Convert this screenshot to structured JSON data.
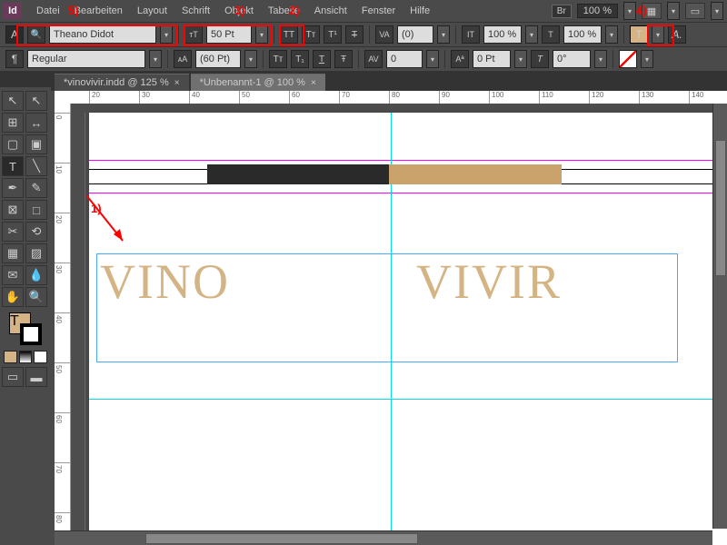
{
  "app": {
    "logo": "Id"
  },
  "menu": [
    "Datei",
    "Bearbeiten",
    "Layout",
    "Schrift",
    "Objekt",
    "Tabelle",
    "Ansicht",
    "Fenster",
    "Hilfe"
  ],
  "top_right": {
    "br": "Br",
    "zoom": "100 %"
  },
  "control": {
    "font_family": "Theano Didot",
    "font_style": "Regular",
    "font_size": "50 Pt",
    "leading": "(60 Pt)",
    "kerning": "(0)",
    "tracking": "0",
    "vscale": "100 %",
    "hscale": "100 %",
    "baseline": "0 Pt"
  },
  "tabs": [
    {
      "label": "*vinovivir.indd @ 125 %",
      "active": false
    },
    {
      "label": "*Unbenannt-1 @ 100 %",
      "active": true
    }
  ],
  "ruler_h": [
    20,
    30,
    40,
    50,
    60,
    70,
    80,
    90,
    100,
    110,
    120,
    130,
    140
  ],
  "ruler_v": [
    0,
    10,
    20,
    30,
    40,
    50,
    60,
    70,
    80
  ],
  "annotations": {
    "a1": "1)",
    "a2": "2)",
    "a3": "3)",
    "a4": "4)",
    "a5": "5)"
  },
  "canvas": {
    "text_left": "VINO",
    "text_right": "VIVIR"
  },
  "colors": {
    "tan": "#d4b485",
    "block_tan": "#c9a26c"
  }
}
